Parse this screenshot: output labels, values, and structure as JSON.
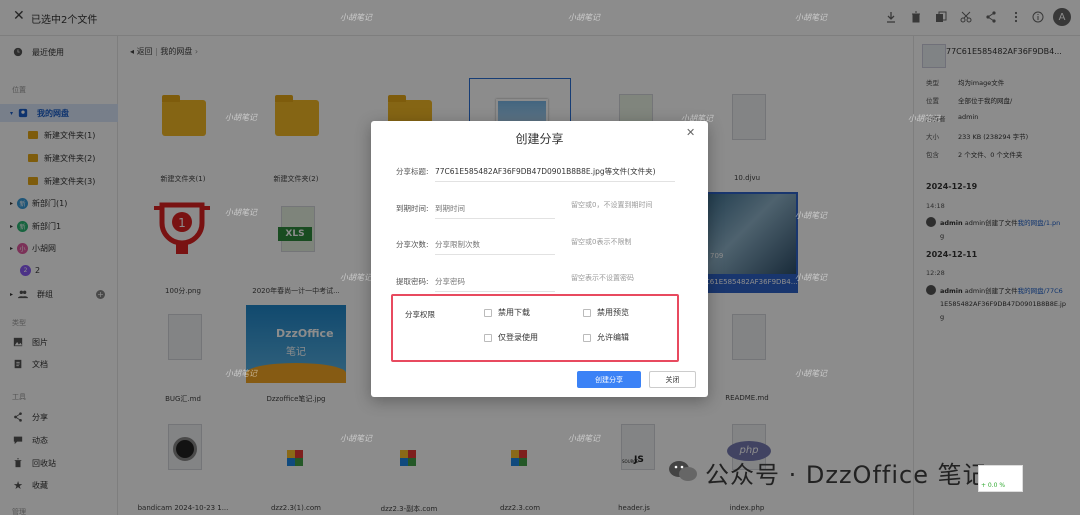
{
  "header": {
    "close_glyph": "✕",
    "title": "已选中2个文件",
    "avatar_letter": "A"
  },
  "sidebar": {
    "recent": "最近使用",
    "section_location": "位置",
    "my_drive": "我的网盘",
    "folders": [
      "新建文件夹(1)",
      "新建文件夹(2)",
      "新建文件夹(3)"
    ],
    "orgs": [
      {
        "badge": "新",
        "label": "新部门(1)",
        "color": "#3a9bd9"
      },
      {
        "badge": "新",
        "label": "新部门1",
        "color": "#2bb673"
      },
      {
        "badge": "小",
        "label": "小胡网",
        "color": "#e05aa0"
      },
      {
        "badge": "2",
        "label": "2",
        "color": "#8b5cf6"
      }
    ],
    "groups": "群组",
    "section_type": "类型",
    "type_items": [
      "图片",
      "文档"
    ],
    "section_tools": "工具",
    "tool_items": [
      "分享",
      "动态",
      "回收站",
      "收藏"
    ],
    "section_manage": "管理"
  },
  "breadcrumb": {
    "back": "返回",
    "current": "我的网盘"
  },
  "files": [
    {
      "name": "新建文件夹(1)"
    },
    {
      "name": "新建文件夹(2)"
    },
    {
      "name": ""
    },
    {
      "name": ""
    },
    {
      "name": ""
    },
    {
      "name": "10.djvu"
    },
    {
      "name": "100分.png"
    },
    {
      "name": "2020年春尚一计一中考试..."
    },
    {
      "name": ""
    },
    {
      "name": ""
    },
    {
      "name": ""
    },
    {
      "name": "77C61E585482AF36F9DB47..."
    },
    {
      "name": "BUG汇.md"
    },
    {
      "name": "Dzzoffice笔记.jpg"
    },
    {
      "name": ""
    },
    {
      "name": ""
    },
    {
      "name": ""
    },
    {
      "name": "README.md"
    },
    {
      "name": "bandicam 2024-10-23 1..."
    },
    {
      "name": "dzz2.3(1).com"
    },
    {
      "name": "dzz2.3-副本.com"
    },
    {
      "name": "dzz2.3.com"
    },
    {
      "name": "header.js"
    },
    {
      "name": "index.php"
    }
  ],
  "thumbs": {
    "xls_label": "XLS",
    "dzz_title": "DzzOffice",
    "dzz_sub": "笔记",
    "trophy_num": "1",
    "php_label": "php",
    "js_label": "JS",
    "source_label": "SOURCE",
    "photo_num": "709"
  },
  "right_panel": {
    "title": "77C61E585482AF36F9DB4...",
    "props": [
      {
        "k": "类型",
        "v": "均为image文件"
      },
      {
        "k": "位置",
        "v": "全部位于我的网盘/"
      },
      {
        "k": "所有者",
        "v": "admin"
      },
      {
        "k": "大小",
        "v": "233 KB (238294 字节)"
      },
      {
        "k": "包含",
        "v": "2 个文件、0 个文件夹"
      }
    ],
    "activity": [
      {
        "date": "2024-12-19",
        "time": "14:18",
        "user": "admin",
        "text": "admin创建了文件",
        "link": "我的网盘/1.pn",
        "tail": "g"
      },
      {
        "date": "2024-12-11",
        "time": "12:28",
        "user": "admin",
        "text": "admin创建了文件",
        "link": "我的网盘/77C6",
        "tail": "1E585482AF36F9DB47D0901B8B8E.jp",
        "tail2": "g"
      }
    ]
  },
  "modal": {
    "title": "创建分享",
    "close_glyph": "✕",
    "share_title_label": "分享标题:",
    "share_title_value": "77C61E585482AF36F9DB47D0901B8B8E.jpg等文件(文件夹)",
    "expire_label": "到期时间:",
    "expire_placeholder": "到期时间",
    "expire_hint": "留空或0，不设置到期时间",
    "count_label": "分享次数:",
    "count_placeholder": "分享限制次数",
    "count_hint": "留空或0表示不限制",
    "code_label": "提取密码:",
    "code_placeholder": "分享密码",
    "code_hint": "留空表示不设置密码",
    "perm_label": "分享权限",
    "perm_options": [
      "禁用下载",
      "禁用预览",
      "仅登录使用",
      "允许编辑"
    ],
    "create_btn": "创建分享",
    "close_btn": "关闭"
  },
  "watermark": {
    "text": "小胡笔记",
    "brand": "公众号 · DzzOffice 笔记",
    "badge": "+ 0.0 %"
  },
  "colors": {
    "accent": "#3b82f6",
    "highlight_border": "#e84a5f",
    "folder": "#f2b825"
  }
}
